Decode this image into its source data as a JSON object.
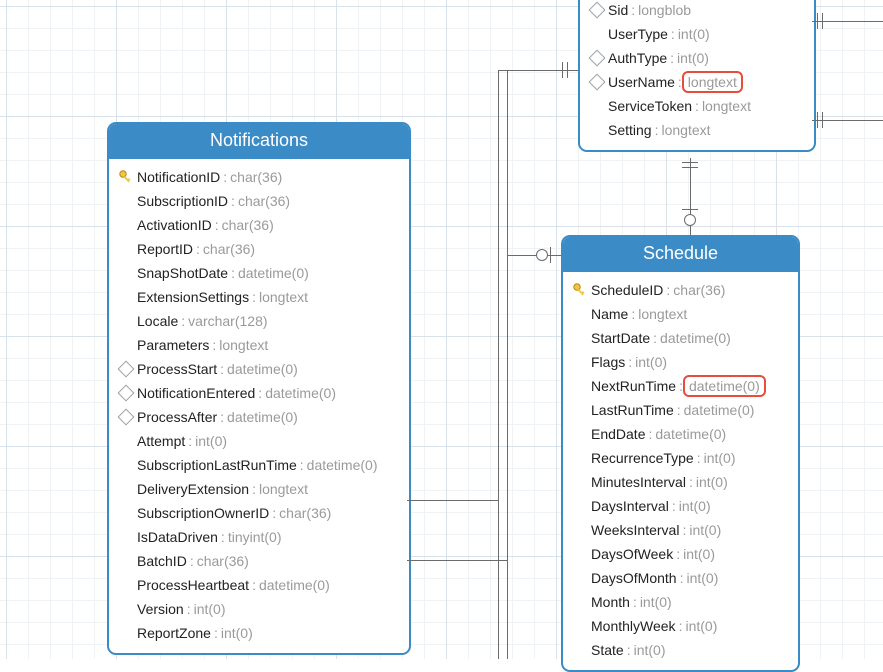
{
  "entities": {
    "top": {
      "fields": [
        {
          "icon": "diamond",
          "name": "Sid",
          "type": "longblob"
        },
        {
          "icon": "",
          "name": "UserType",
          "type": "int(0)"
        },
        {
          "icon": "diamond",
          "name": "AuthType",
          "type": "int(0)"
        },
        {
          "icon": "diamond",
          "name": "UserName",
          "type": "longtext",
          "highlight": true
        },
        {
          "icon": "",
          "name": "ServiceToken",
          "type": "longtext"
        },
        {
          "icon": "",
          "name": "Setting",
          "type": "longtext"
        }
      ]
    },
    "notifications": {
      "title": "Notifications",
      "fields": [
        {
          "icon": "key",
          "name": "NotificationID",
          "type": "char(36)"
        },
        {
          "icon": "",
          "name": "SubscriptionID",
          "type": "char(36)"
        },
        {
          "icon": "",
          "name": "ActivationID",
          "type": "char(36)"
        },
        {
          "icon": "",
          "name": "ReportID",
          "type": "char(36)"
        },
        {
          "icon": "",
          "name": "SnapShotDate",
          "type": "datetime(0)"
        },
        {
          "icon": "",
          "name": "ExtensionSettings",
          "type": "longtext"
        },
        {
          "icon": "",
          "name": "Locale",
          "type": "varchar(128)"
        },
        {
          "icon": "",
          "name": "Parameters",
          "type": "longtext"
        },
        {
          "icon": "diamond",
          "name": "ProcessStart",
          "type": "datetime(0)"
        },
        {
          "icon": "diamond",
          "name": "NotificationEntered",
          "type": "datetime(0)"
        },
        {
          "icon": "diamond",
          "name": "ProcessAfter",
          "type": "datetime(0)"
        },
        {
          "icon": "",
          "name": "Attempt",
          "type": "int(0)"
        },
        {
          "icon": "",
          "name": "SubscriptionLastRunTime",
          "type": "datetime(0)"
        },
        {
          "icon": "",
          "name": "DeliveryExtension",
          "type": "longtext"
        },
        {
          "icon": "",
          "name": "SubscriptionOwnerID",
          "type": "char(36)"
        },
        {
          "icon": "",
          "name": "IsDataDriven",
          "type": "tinyint(0)"
        },
        {
          "icon": "",
          "name": "BatchID",
          "type": "char(36)"
        },
        {
          "icon": "",
          "name": "ProcessHeartbeat",
          "type": "datetime(0)"
        },
        {
          "icon": "",
          "name": "Version",
          "type": "int(0)"
        },
        {
          "icon": "",
          "name": "ReportZone",
          "type": "int(0)"
        }
      ]
    },
    "schedule": {
      "title": "Schedule",
      "fields": [
        {
          "icon": "key",
          "name": "ScheduleID",
          "type": "char(36)"
        },
        {
          "icon": "",
          "name": "Name",
          "type": "longtext"
        },
        {
          "icon": "",
          "name": "StartDate",
          "type": "datetime(0)"
        },
        {
          "icon": "",
          "name": "Flags",
          "type": "int(0)"
        },
        {
          "icon": "",
          "name": "NextRunTime",
          "type": "datetime(0)",
          "highlight": true
        },
        {
          "icon": "",
          "name": "LastRunTime",
          "type": "datetime(0)"
        },
        {
          "icon": "",
          "name": "EndDate",
          "type": "datetime(0)"
        },
        {
          "icon": "",
          "name": "RecurrenceType",
          "type": "int(0)"
        },
        {
          "icon": "",
          "name": "MinutesInterval",
          "type": "int(0)"
        },
        {
          "icon": "",
          "name": "DaysInterval",
          "type": "int(0)"
        },
        {
          "icon": "",
          "name": "WeeksInterval",
          "type": "int(0)"
        },
        {
          "icon": "",
          "name": "DaysOfWeek",
          "type": "int(0)"
        },
        {
          "icon": "",
          "name": "DaysOfMonth",
          "type": "int(0)"
        },
        {
          "icon": "",
          "name": "Month",
          "type": "int(0)"
        },
        {
          "icon": "",
          "name": "MonthlyWeek",
          "type": "int(0)"
        },
        {
          "icon": "",
          "name": "State",
          "type": "int(0)"
        }
      ]
    }
  }
}
